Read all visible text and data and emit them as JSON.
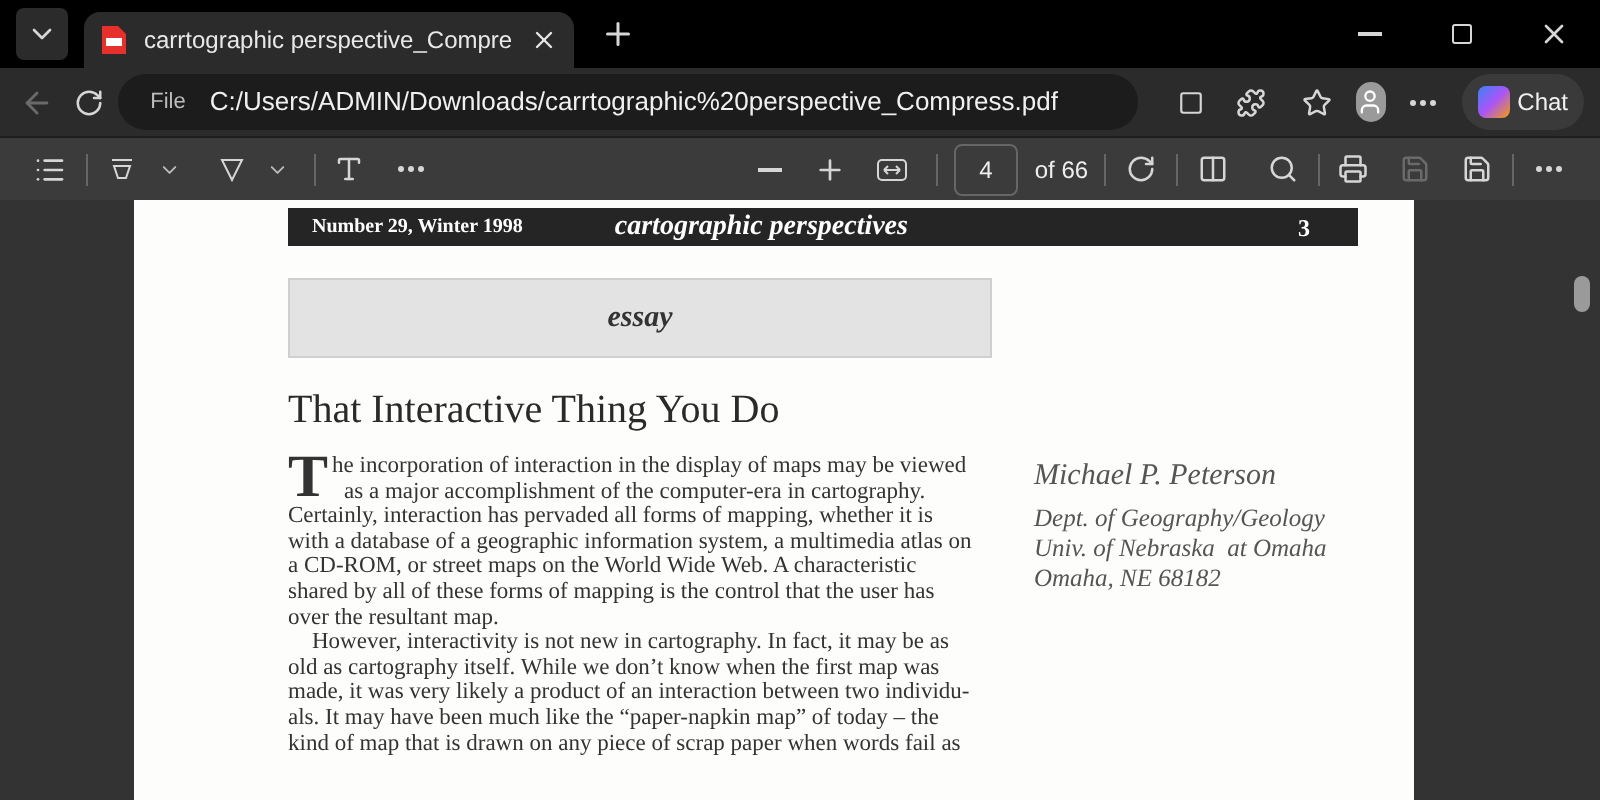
{
  "tab": {
    "title": "carrtographic perspective_Compre",
    "selected": true
  },
  "address_bar": {
    "back_disabled": true,
    "scheme": "File",
    "url": "C:/Users/ADMIN/Downloads/carrtographic%20perspective_Compress.pdf"
  },
  "chat_button": {
    "label": "Chat"
  },
  "pdf_toolbar": {
    "page_number": "4",
    "page_count": "of 66",
    "save_disabled": true
  },
  "document": {
    "header": {
      "issue": "Number 29, Winter 1998",
      "journal": "cartographic perspectives",
      "page": "3"
    },
    "section_label": "essay",
    "title": "That Interactive Thing You Do",
    "paragraphs": [
      {
        "drop_cap": "T",
        "lines": [
          "he incorporation of interaction in the display of maps may be viewed",
          "as a major accomplishment of the computer-era in cartography.",
          "Certainly, interaction has pervaded all forms of mapping, whether it is",
          "with a database of a geographic information system, a multimedia atlas on",
          "a CD-ROM, or street maps on the World Wide Web. A characteristic",
          "shared by all of these forms of mapping is the control that the user has",
          "over the resultant map."
        ]
      },
      {
        "lines": [
          "However, interactivity is not new in cartography. In fact, it may be as",
          "old as cartography itself. While we don’t know when the first map was",
          "made, it was very likely a product of an interaction between two individu-",
          "als. It may have been much like the “paper-napkin map” of today – the",
          "kind of map that is drawn on any piece of scrap paper when words fail as"
        ]
      }
    ],
    "author": {
      "name": "Michael P. Peterson",
      "affiliation": [
        "Dept. of Geography/Geology",
        "Univ. of Nebraska  at Omaha",
        "Omaha, NE 68182"
      ]
    }
  }
}
